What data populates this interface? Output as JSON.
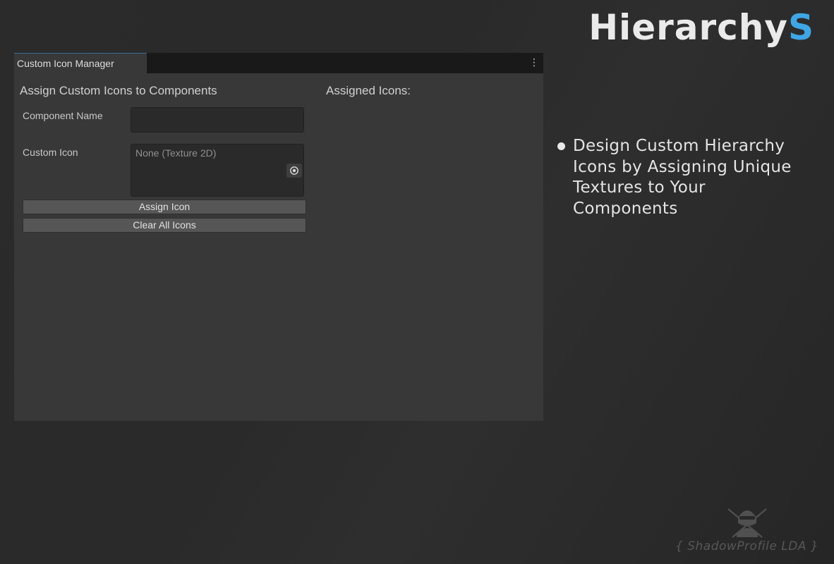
{
  "brand": {
    "name_main": "Hierarchy",
    "name_accent": "S",
    "accent_color": "#3fa6e6"
  },
  "window": {
    "tab_label": "Custom Icon Manager",
    "menu_icon": "kebab-menu-icon",
    "left_section_title": "Assign Custom Icons to Components",
    "right_section_title": "Assigned Icons:",
    "fields": {
      "component_name_label": "Component Name",
      "component_name_value": "",
      "custom_icon_label": "Custom Icon",
      "custom_icon_value": "None (Texture 2D)",
      "custom_icon_picker_icon": "object-picker-icon"
    },
    "buttons": {
      "assign_label": "Assign Icon",
      "clear_label": "Clear All Icons"
    }
  },
  "feature": {
    "text": "Design Custom Hierarchy Icons by Assigning Unique Textures to Your Components"
  },
  "watermark": {
    "text": "{ ShadowProfile LDA }",
    "logo_icon": "ninja-logo-icon"
  }
}
